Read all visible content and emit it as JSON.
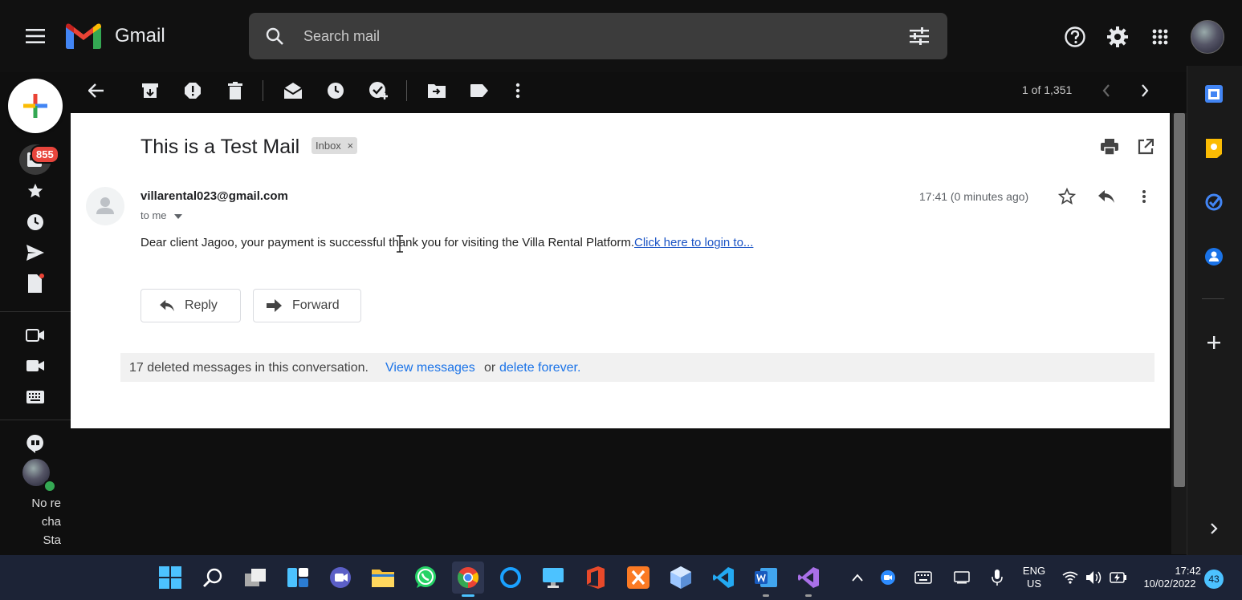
{
  "app": {
    "name": "Gmail"
  },
  "search": {
    "placeholder": "Search mail"
  },
  "left_rail": {
    "unread_badge": "855",
    "status_text_lines": [
      "No re",
      "cha",
      "Sta"
    ]
  },
  "toolbar": {
    "page_count": "1 of 1,351"
  },
  "email": {
    "subject": "This is a Test Mail",
    "label_tag": "Inbox",
    "label_close": "×",
    "sender": "villarental023@gmail.com",
    "recipient": "to me",
    "time": "17:41 (0 minutes ago)",
    "body_text": "Dear client Jagoo, your payment is successful thank you for visiting the Villa Rental Platform.",
    "body_link": "Click here to login to...",
    "reply_label": "Reply",
    "forward_label": "Forward",
    "deleted_notice": "17 deleted messages in this conversation.",
    "view_messages": "View messages",
    "or_text": "or",
    "delete_forever": "delete forever."
  },
  "taskbar": {
    "language": [
      "ENG",
      "US"
    ],
    "clock_time": "17:42",
    "clock_date": "10/02/2022",
    "notification_count": "43"
  },
  "colors": {
    "gmail_red": "#ea4335",
    "gmail_blue": "#4285f4",
    "gmail_yellow": "#fbbc04",
    "gmail_green": "#34a853",
    "link": "#1a73e8",
    "taskbar": "#1c2336"
  }
}
